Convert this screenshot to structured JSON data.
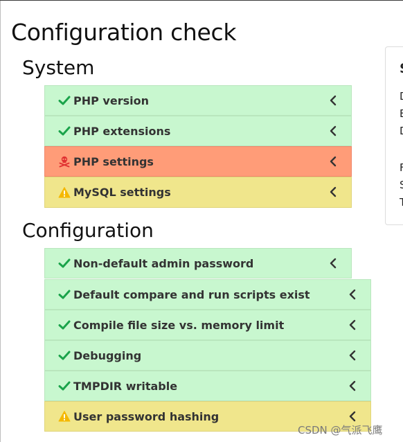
{
  "page": {
    "title": "Configuration check"
  },
  "sections": {
    "system": {
      "heading": "System",
      "items": [
        {
          "label": "PHP version",
          "status": "ok"
        },
        {
          "label": "PHP extensions",
          "status": "ok"
        },
        {
          "label": "PHP settings",
          "status": "error"
        },
        {
          "label": "MySQL settings",
          "status": "warning"
        }
      ]
    },
    "configuration": {
      "heading": "Configuration",
      "items": [
        {
          "label": "Non-default admin password",
          "status": "ok"
        },
        {
          "label": "Default compare and run scripts exist",
          "status": "ok"
        },
        {
          "label": "Compile file size vs. memory limit",
          "status": "ok"
        },
        {
          "label": "Debugging",
          "status": "ok"
        },
        {
          "label": "TMPDIR writable",
          "status": "ok"
        },
        {
          "label": "User password hashing",
          "status": "warning"
        }
      ]
    }
  },
  "side_panel": {
    "title": "S",
    "lines": [
      "D",
      "E",
      "D",
      "",
      "F",
      "S",
      "T"
    ]
  },
  "watermark": "CSDN @气派飞鹰",
  "colors": {
    "ok": "#c8f7cf",
    "warning": "#f0e68c",
    "error": "#ff9c78",
    "check_icon": "#1aa34a",
    "warning_icon": "#f5b800",
    "error_icon": "#e03131"
  },
  "icons": {
    "ok": "checkmark-icon",
    "warning": "warning-triangle-icon",
    "error": "skull-crossbones-icon",
    "expand": "chevron-left-icon"
  }
}
